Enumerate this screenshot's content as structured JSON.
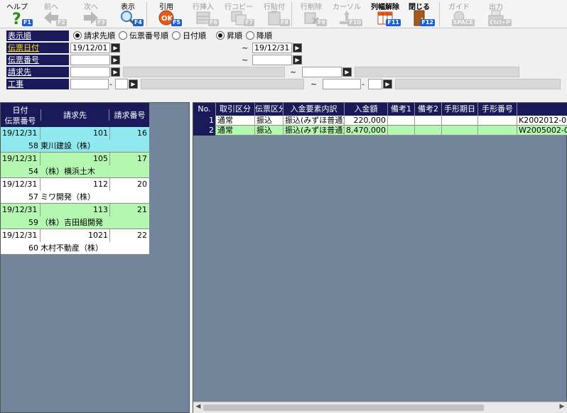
{
  "toolbar": {
    "buttons": [
      {
        "label": "ヘルプ",
        "key": "F1",
        "icon": "help-icon",
        "enabled": true
      },
      {
        "label": "前へ",
        "key": "F2",
        "icon": "arrow-left-icon",
        "enabled": false
      },
      {
        "label": "次へ",
        "key": "F3",
        "icon": "arrow-right-icon",
        "enabled": false
      },
      {
        "label": "表示",
        "key": "F4",
        "icon": "magnifier-icon",
        "enabled": true
      },
      {
        "label": "引用",
        "key": "F5",
        "icon": "ok-icon",
        "enabled": true
      },
      {
        "label": "行挿入",
        "key": "F6",
        "icon": "row-insert-icon",
        "enabled": false
      },
      {
        "label": "行コピー",
        "key": "F7",
        "icon": "row-copy-icon",
        "enabled": false
      },
      {
        "label": "行貼付",
        "key": "F8",
        "icon": "row-paste-icon",
        "enabled": false
      },
      {
        "label": "行削除",
        "key": "F9",
        "icon": "row-delete-icon",
        "enabled": false
      },
      {
        "label": "カーソル",
        "key": "F10",
        "icon": "cursor-icon",
        "enabled": false
      },
      {
        "label": "列幅解除",
        "key": "F11",
        "icon": "column-width-icon",
        "enabled": true
      },
      {
        "label": "閉じる",
        "key": "F12",
        "icon": "close-door-icon",
        "enabled": true
      },
      {
        "label": "ガイド",
        "key": "SPACE",
        "icon": "guide-bulb-icon",
        "enabled": false
      },
      {
        "label": "出力",
        "key": "Ctrl+P",
        "icon": "print-icon",
        "enabled": false
      }
    ]
  },
  "search": {
    "sort_label": "表示順",
    "sort_options": [
      "請求先順",
      "伝票番号順",
      "日付順"
    ],
    "order_options": [
      "昇順",
      "降順"
    ],
    "date_label": "伝票日付",
    "date_from": "19/12/01",
    "date_to": "19/12/31",
    "slip_label": "伝票番号",
    "slip_from": "",
    "slip_to": "",
    "client_label": "請求先",
    "client_from": "",
    "client_to": "",
    "project_label": "工事",
    "project_from_a": "",
    "project_from_b": "",
    "project_to_a": "",
    "project_to_b": "",
    "tilde": "~",
    "dash": "-"
  },
  "left_grid": {
    "headers": {
      "date": "日付",
      "slip_no": "伝票番号",
      "client": "請求先",
      "bill_no": "請求番号"
    },
    "rows": [
      {
        "date": "19/12/31",
        "client_code": "101",
        "bill_no": "16",
        "slip_no": "58",
        "client_name": "東川建設（株）"
      },
      {
        "date": "19/12/31",
        "client_code": "105",
        "bill_no": "17",
        "slip_no": "54",
        "client_name": "（株）横浜土木"
      },
      {
        "date": "19/12/31",
        "client_code": "112",
        "bill_no": "20",
        "slip_no": "57",
        "client_name": "ミワ開発（株）"
      },
      {
        "date": "19/12/31",
        "client_code": "113",
        "bill_no": "21",
        "slip_no": "59",
        "client_name": "（株）吉田組開発"
      },
      {
        "date": "19/12/31",
        "client_code": "1021",
        "bill_no": "22",
        "slip_no": "60",
        "client_name": "木村不動産（株）"
      }
    ]
  },
  "right_grid": {
    "headers": [
      "No.",
      "取引区分",
      "伝票区分",
      "入金要素内訳",
      "入金額",
      "備考1",
      "備考2",
      "手形期日",
      "手形番号",
      ""
    ],
    "rows": [
      {
        "no": "1",
        "type": "通常",
        "slip_type": "振込",
        "detail": "振込(みずほ普通)",
        "amount": "220,000",
        "note1": "",
        "note2": "",
        "due": "",
        "bill": "",
        "ref": "K2002012-0"
      },
      {
        "no": "2",
        "type": "通常",
        "slip_type": "振込",
        "detail": "振込(みずほ普通)",
        "amount": "8,470,000",
        "note1": "",
        "note2": "",
        "due": "",
        "bill": "",
        "ref": "W2005002-0"
      }
    ]
  }
}
